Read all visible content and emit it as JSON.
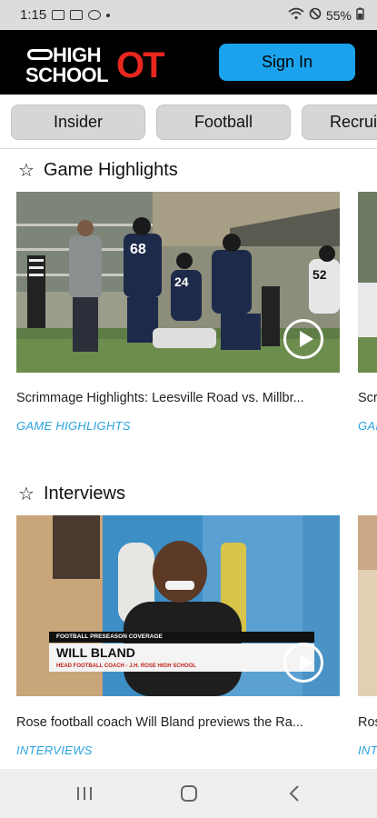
{
  "status_bar": {
    "time": "1:15",
    "battery": "55%"
  },
  "header": {
    "logo_high": "HIGH",
    "logo_school": "SCHOOL",
    "logo_ot": "OT",
    "sign_in_label": "Sign In"
  },
  "tabs": [
    {
      "label": "Insider"
    },
    {
      "label": "Football"
    },
    {
      "label": "Recrui"
    }
  ],
  "sections": [
    {
      "title": "Game Highlights",
      "cards": [
        {
          "title": "Scrimmage Highlights: Leesville Road vs. Millbr...",
          "category": "GAME HIGHLIGHTS",
          "overlay": {
            "jersey_a": "68",
            "jersey_b": "24",
            "jersey_c": "52"
          }
        },
        {
          "title": "Scr",
          "category": "GAI"
        }
      ]
    },
    {
      "title": "Interviews",
      "cards": [
        {
          "title": "Rose football coach Will Bland previews the Ra...",
          "category": "INTERVIEWS",
          "overlay": {
            "banner_top": "FOOTBALL PRESEASON COVERAGE",
            "banner_name": "WILL BLAND",
            "banner_sub": "HEAD FOOTBALL COACH - J.H. ROSE HIGH SCHOOL"
          }
        },
        {
          "title": "Ros",
          "category": "INT"
        }
      ]
    }
  ],
  "colors": {
    "accent": "#1aa3ec",
    "brand_red": "#e8271f",
    "category_blue": "#2aa3e0"
  }
}
